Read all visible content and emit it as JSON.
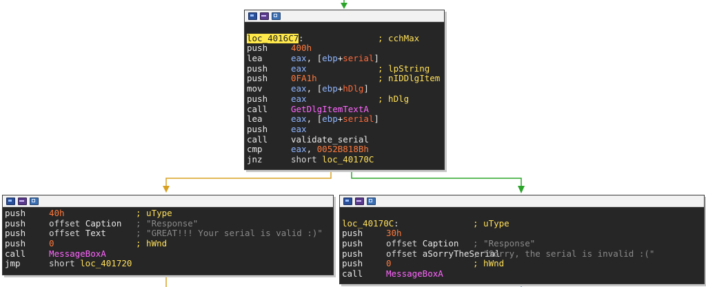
{
  "colors": {
    "block_bg": "#262626",
    "edge_true": "#2aa52a",
    "edge_false": "#d9a020",
    "edge_neutral": "#6699cc",
    "mnemonic": "#e8e8e8",
    "register": "#8fb6ff",
    "immediate": "#ff7a3d",
    "function": "#ff66ff",
    "label": "#ffe05a",
    "comment": "#ffe05a",
    "string_comment": "#8a8a8a"
  },
  "toolbar_icons": [
    "window-icon",
    "graph-icon",
    "code-icon"
  ],
  "block_main": {
    "label_line": {
      "label": "loc_4016C7",
      "colon": ":",
      "comment": "; cchMax"
    },
    "lines": [
      {
        "mnemonic": "push",
        "operands": [
          {
            "t": "400h",
            "c": "num"
          }
        ],
        "comment": ""
      },
      {
        "mnemonic": "lea",
        "operands": [
          {
            "t": "eax",
            "c": "reg"
          },
          {
            "t": ", [",
            "c": "plain"
          },
          {
            "t": "ebp",
            "c": "reg"
          },
          {
            "t": "+",
            "c": "plain"
          },
          {
            "t": "serial",
            "c": "var"
          },
          {
            "t": "]",
            "c": "plain"
          }
        ],
        "comment": ""
      },
      {
        "mnemonic": "push",
        "operands": [
          {
            "t": "eax",
            "c": "reg"
          }
        ],
        "comment": "; lpString"
      },
      {
        "mnemonic": "push",
        "operands": [
          {
            "t": "0FA1h",
            "c": "num"
          }
        ],
        "comment": "; nIDDlgItem"
      },
      {
        "mnemonic": "mov",
        "operands": [
          {
            "t": "eax",
            "c": "reg"
          },
          {
            "t": ", [",
            "c": "plain"
          },
          {
            "t": "ebp",
            "c": "reg"
          },
          {
            "t": "+",
            "c": "plain"
          },
          {
            "t": "hDlg",
            "c": "var"
          },
          {
            "t": "]",
            "c": "plain"
          }
        ],
        "comment": ""
      },
      {
        "mnemonic": "push",
        "operands": [
          {
            "t": "eax",
            "c": "reg"
          }
        ],
        "comment": "; hDlg"
      },
      {
        "mnemonic": "call",
        "operands": [
          {
            "t": "GetDlgItemTextA",
            "c": "fn"
          }
        ],
        "comment": ""
      },
      {
        "mnemonic": "lea",
        "operands": [
          {
            "t": "eax",
            "c": "reg"
          },
          {
            "t": ", [",
            "c": "plain"
          },
          {
            "t": "ebp",
            "c": "reg"
          },
          {
            "t": "+",
            "c": "plain"
          },
          {
            "t": "serial",
            "c": "var"
          },
          {
            "t": "]",
            "c": "plain"
          }
        ],
        "comment": ""
      },
      {
        "mnemonic": "push",
        "operands": [
          {
            "t": "eax",
            "c": "reg"
          }
        ],
        "comment": ""
      },
      {
        "mnemonic": "call",
        "operands": [
          {
            "t": "validate_serial",
            "c": "plain"
          }
        ],
        "comment": ""
      },
      {
        "mnemonic": "cmp",
        "operands": [
          {
            "t": "eax",
            "c": "reg"
          },
          {
            "t": ", ",
            "c": "plain"
          },
          {
            "t": "0052B818Bh",
            "c": "num"
          }
        ],
        "comment": ""
      },
      {
        "mnemonic": "jnz",
        "operands": [
          {
            "t": "short ",
            "c": "kw"
          },
          {
            "t": "loc_40170C",
            "c": "lbl"
          }
        ],
        "comment": ""
      }
    ]
  },
  "block_left": {
    "lines": [
      {
        "mnemonic": "push",
        "operands": [
          {
            "t": "40h",
            "c": "num"
          }
        ],
        "comment": "; uType",
        "ccls": "cmt"
      },
      {
        "mnemonic": "push",
        "operands": [
          {
            "t": "offset ",
            "c": "kw"
          },
          {
            "t": "Caption",
            "c": "plain"
          }
        ],
        "comment": "; \"Response\"",
        "ccls": "str"
      },
      {
        "mnemonic": "push",
        "operands": [
          {
            "t": "offset ",
            "c": "kw"
          },
          {
            "t": "Text",
            "c": "plain"
          }
        ],
        "comment": "; \"GREAT!!! Your serial is valid :)\"",
        "ccls": "str"
      },
      {
        "mnemonic": "push",
        "operands": [
          {
            "t": "0",
            "c": "num"
          }
        ],
        "comment": "; hWnd",
        "ccls": "cmt"
      },
      {
        "mnemonic": "call",
        "operands": [
          {
            "t": "MessageBoxA",
            "c": "fn"
          }
        ],
        "comment": "",
        "ccls": "cmt"
      },
      {
        "mnemonic": "jmp",
        "operands": [
          {
            "t": "short ",
            "c": "kw"
          },
          {
            "t": "loc_401720",
            "c": "lbl"
          }
        ],
        "comment": "",
        "ccls": "cmt"
      }
    ]
  },
  "block_right": {
    "label_line": {
      "label": "loc_40170C",
      "colon": ":",
      "comment": "; uType"
    },
    "lines": [
      {
        "mnemonic": "push",
        "operands": [
          {
            "t": "30h",
            "c": "num"
          }
        ],
        "comment": "",
        "ccls": "cmt"
      },
      {
        "mnemonic": "push",
        "operands": [
          {
            "t": "offset ",
            "c": "kw"
          },
          {
            "t": "Caption",
            "c": "plain"
          }
        ],
        "comment": "; \"Response\"",
        "ccls": "str"
      },
      {
        "mnemonic": "push",
        "operands": [
          {
            "t": "offset ",
            "c": "kw"
          },
          {
            "t": "aSorryTheSerial",
            "c": "plain"
          }
        ],
        "comment": "; \"Sorry, the serial is invalid :(\"",
        "ccls": "str"
      },
      {
        "mnemonic": "push",
        "operands": [
          {
            "t": "0",
            "c": "num"
          }
        ],
        "comment": "; hWnd",
        "ccls": "cmt"
      },
      {
        "mnemonic": "call",
        "operands": [
          {
            "t": "MessageBoxA",
            "c": "fn"
          }
        ],
        "comment": "",
        "ccls": "cmt"
      }
    ]
  }
}
